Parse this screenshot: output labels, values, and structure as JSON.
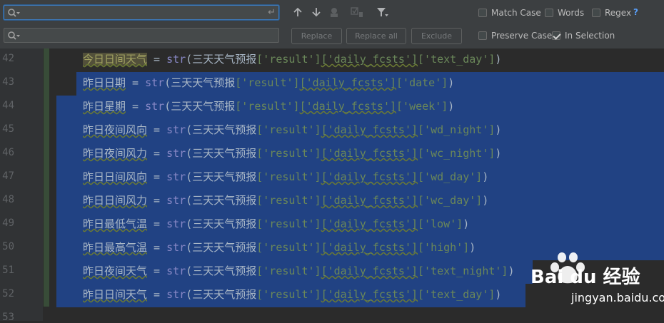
{
  "findbar": {
    "search": {
      "value": "",
      "placeholder": ""
    },
    "replace": {
      "value": "",
      "placeholder": ""
    },
    "options": {
      "match_case": {
        "label": "Match Case",
        "checked": false
      },
      "words": {
        "label": "Words",
        "checked": false
      },
      "regex": {
        "label": "Regex",
        "checked": false
      },
      "preserve_case": {
        "label": "Preserve Case",
        "checked": false
      },
      "in_selection": {
        "label": "In Selection",
        "checked": true
      }
    },
    "help": "?",
    "buttons": {
      "replace": "Replace",
      "replace_all": "Replace all",
      "exclude": "Exclude"
    },
    "icons": [
      "search-history-icon",
      "enter-icon",
      "arrow-up-icon",
      "arrow-down-icon",
      "find-in-path-icon",
      "select-all-occurrences-icon",
      "filter-icon"
    ]
  },
  "editor": {
    "lines": [
      {
        "num": "42",
        "var": "今日日间天气",
        "field": "text_day"
      },
      {
        "num": "43",
        "var": "昨日日期",
        "field": "date"
      },
      {
        "num": "44",
        "var": "昨日星期",
        "field": "week"
      },
      {
        "num": "45",
        "var": "昨日夜间风向",
        "field": "wd_night"
      },
      {
        "num": "46",
        "var": "昨日夜间风力",
        "field": "wc_night"
      },
      {
        "num": "47",
        "var": "昨日日间风向",
        "field": "wd_day"
      },
      {
        "num": "48",
        "var": "昨日日间风力",
        "field": "wc_day"
      },
      {
        "num": "49",
        "var": "昨日最低气温",
        "field": "low"
      },
      {
        "num": "50",
        "var": "昨日最高气温",
        "field": "high"
      },
      {
        "num": "51",
        "var": "昨日夜间天气",
        "field": "text_night"
      },
      {
        "num": "52",
        "var": "昨日日间天气",
        "field": "text_day"
      },
      {
        "num": "53",
        "var": "",
        "field": ""
      }
    ],
    "tokens": {
      "eq": " = ",
      "fn": "str",
      "lparen": "(",
      "obj": "三天天气预报",
      "k1": "['result']",
      "k2": "['daily_fcsts']",
      "rparen": ")"
    }
  },
  "watermark": {
    "logo": "Bai du 经验",
    "url": "jingyan.baidu.com"
  },
  "colors": {
    "background": "#2b2b2b",
    "selection": "#214283",
    "string": "#6a8759",
    "accent": "#3d7bbd"
  }
}
